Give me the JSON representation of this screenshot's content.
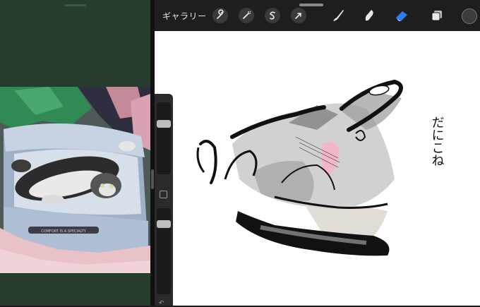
{
  "toolbar": {
    "gallery_label": "ギャラリー",
    "actions": [
      "wrench-icon",
      "magic-wand-icon",
      "selection-icon",
      "transform-icon"
    ],
    "tools": [
      "brush-icon",
      "smudge-icon",
      "eraser-icon",
      "layers-icon"
    ],
    "active_tool": "eraser-icon",
    "accent_color": "#2f7bf6",
    "current_color": "#3c3c3c"
  },
  "reference_photo": {
    "subject": "cat-in-pet-bed",
    "bed_text": "COMFORT IS A SPECIALTY"
  },
  "sidebar": {
    "brush_size": 0.72,
    "opacity": 0.85
  },
  "canvas": {
    "handwriting": "だにこね"
  },
  "colors": {
    "left_background": "#263d2d",
    "toolbar": "#1e1e1e",
    "canvas": "#ffffff"
  }
}
